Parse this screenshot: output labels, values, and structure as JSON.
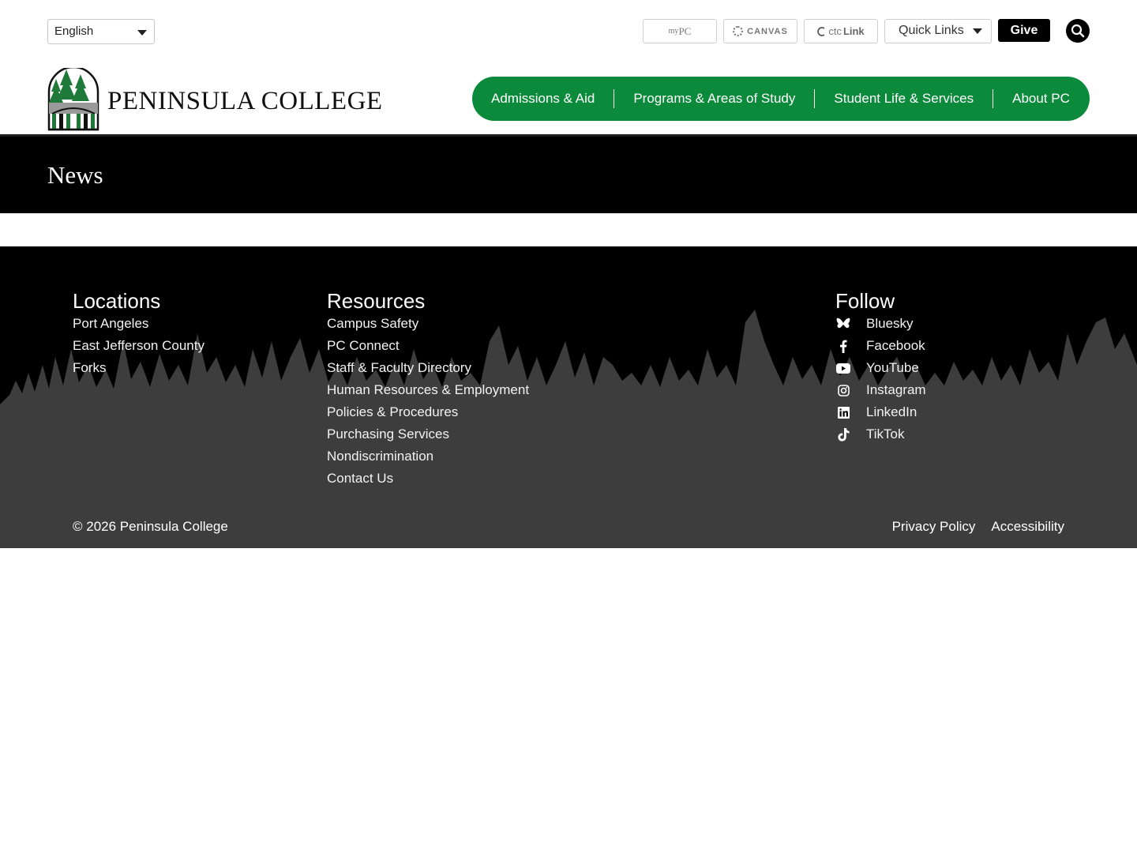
{
  "utility": {
    "language": "English",
    "portals": {
      "mypc_small": "my",
      "mypc_big": "PC",
      "canvas": "CANVAS",
      "ctclink_prefix": "ctc",
      "ctclink_suffix": "Link"
    },
    "quick_links": "Quick Links",
    "give": "Give",
    "search_icon": "search-icon"
  },
  "header": {
    "logo_text": "PENINSULA COLLEGE",
    "nav": [
      "Admissions & Aid",
      "Programs & Areas of Study",
      "Student Life & Services",
      "About PC"
    ]
  },
  "banner": {
    "title": "News"
  },
  "footer": {
    "locations": {
      "heading": "Locations",
      "links": [
        "Port Angeles",
        "East Jefferson County",
        "Forks"
      ]
    },
    "resources": {
      "heading": "Resources",
      "links": [
        "Campus Safety",
        "PC Connect",
        "Staff & Faculty Directory",
        "Human Resources & Employment",
        "Policies & Procedures",
        "Purchasing Services",
        "Nondiscrimination",
        "Contact Us"
      ]
    },
    "follow": {
      "heading": "Follow",
      "links": [
        {
          "label": "Bluesky",
          "icon": "bluesky-icon"
        },
        {
          "label": "Facebook",
          "icon": "facebook-icon"
        },
        {
          "label": "YouTube",
          "icon": "youtube-icon"
        },
        {
          "label": "Instagram",
          "icon": "instagram-icon"
        },
        {
          "label": "LinkedIn",
          "icon": "linkedin-icon"
        },
        {
          "label": "TikTok",
          "icon": "tiktok-icon"
        }
      ]
    },
    "copyright": "© 2026 Peninsula College",
    "legal": [
      "Privacy Policy",
      "Accessibility"
    ]
  },
  "colors": {
    "brand_green": "#0b8a3b",
    "black": "#000000",
    "footer_bottom": "#3d3d3d"
  }
}
